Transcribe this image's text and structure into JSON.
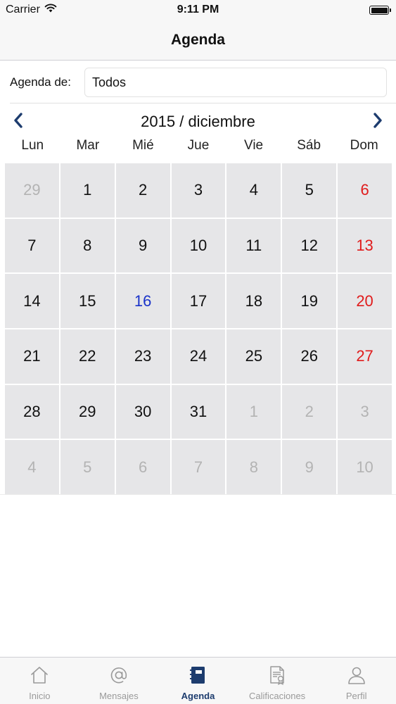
{
  "status_bar": {
    "carrier": "Carrier",
    "time": "9:11 PM"
  },
  "nav": {
    "title": "Agenda"
  },
  "filter": {
    "label": "Agenda de:",
    "value": "Todos"
  },
  "calendar": {
    "month_title": "2015 / diciembre",
    "weekdays": [
      "Lun",
      "Mar",
      "Mié",
      "Jue",
      "Vie",
      "Sáb",
      "Dom"
    ],
    "weeks": [
      [
        "29",
        "1",
        "2",
        "3",
        "4",
        "5",
        "6"
      ],
      [
        "7",
        "8",
        "9",
        "10",
        "11",
        "12",
        "13"
      ],
      [
        "14",
        "15",
        "16",
        "17",
        "18",
        "19",
        "20"
      ],
      [
        "21",
        "22",
        "23",
        "24",
        "25",
        "26",
        "27"
      ],
      [
        "28",
        "29",
        "30",
        "31",
        "1",
        "2",
        "3"
      ],
      [
        "4",
        "5",
        "6",
        "7",
        "8",
        "9",
        "10"
      ]
    ],
    "today": "16"
  },
  "colors": {
    "accent": "#1d3c6e",
    "sunday": "#e01b1b",
    "today": "#1a33c9",
    "other_month": "#b3b3b3",
    "cell_bg": "#e6e6e8"
  },
  "tabs": [
    {
      "label": "Inicio",
      "icon": "home-icon",
      "active": false
    },
    {
      "label": "Mensajes",
      "icon": "at-icon",
      "active": false
    },
    {
      "label": "Agenda",
      "icon": "notebook-icon",
      "active": true
    },
    {
      "label": "Calificaciones",
      "icon": "certificate-icon",
      "active": false
    },
    {
      "label": "Perfil",
      "icon": "user-icon",
      "active": false
    }
  ]
}
